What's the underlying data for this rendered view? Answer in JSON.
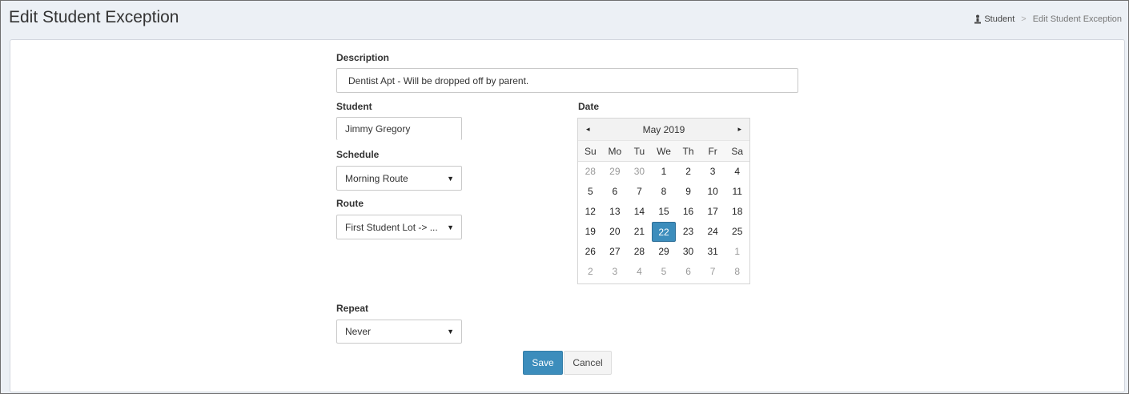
{
  "page": {
    "title": "Edit Student Exception"
  },
  "breadcrumb": {
    "home_label": "Student",
    "separator": ">",
    "current": "Edit Student Exception"
  },
  "form": {
    "description": {
      "label": "Description",
      "value": "Dentist Apt - Will be dropped off by parent."
    },
    "student": {
      "label": "Student",
      "value": "Jimmy Gregory"
    },
    "schedule": {
      "label": "Schedule",
      "value": "Morning Route"
    },
    "route": {
      "label": "Route",
      "value": "First Student Lot -> ..."
    },
    "repeat": {
      "label": "Repeat",
      "value": "Never"
    },
    "date": {
      "label": "Date"
    }
  },
  "calendar": {
    "month_label": "May 2019",
    "prev_icon": "◂",
    "next_icon": "▸",
    "weekdays": [
      "Su",
      "Mo",
      "Tu",
      "We",
      "Th",
      "Fr",
      "Sa"
    ],
    "weeks": [
      [
        {
          "d": "28",
          "m": true
        },
        {
          "d": "29",
          "m": true
        },
        {
          "d": "30",
          "m": true
        },
        {
          "d": "1"
        },
        {
          "d": "2"
        },
        {
          "d": "3"
        },
        {
          "d": "4"
        }
      ],
      [
        {
          "d": "5"
        },
        {
          "d": "6"
        },
        {
          "d": "7"
        },
        {
          "d": "8"
        },
        {
          "d": "9"
        },
        {
          "d": "10"
        },
        {
          "d": "11"
        }
      ],
      [
        {
          "d": "12"
        },
        {
          "d": "13"
        },
        {
          "d": "14"
        },
        {
          "d": "15"
        },
        {
          "d": "16"
        },
        {
          "d": "17"
        },
        {
          "d": "18"
        }
      ],
      [
        {
          "d": "19"
        },
        {
          "d": "20"
        },
        {
          "d": "21"
        },
        {
          "d": "22",
          "s": true
        },
        {
          "d": "23"
        },
        {
          "d": "24"
        },
        {
          "d": "25"
        }
      ],
      [
        {
          "d": "26"
        },
        {
          "d": "27"
        },
        {
          "d": "28"
        },
        {
          "d": "29"
        },
        {
          "d": "30"
        },
        {
          "d": "31"
        },
        {
          "d": "1",
          "m": true
        }
      ],
      [
        {
          "d": "2",
          "m": true
        },
        {
          "d": "3",
          "m": true
        },
        {
          "d": "4",
          "m": true
        },
        {
          "d": "5",
          "m": true
        },
        {
          "d": "6",
          "m": true
        },
        {
          "d": "7",
          "m": true
        },
        {
          "d": "8",
          "m": true
        }
      ]
    ],
    "selected_color": "#3c8dbc"
  },
  "actions": {
    "save_label": "Save",
    "cancel_label": "Cancel"
  },
  "colors": {
    "primary": "#3c8dbc",
    "background": "#ecf0f5"
  }
}
